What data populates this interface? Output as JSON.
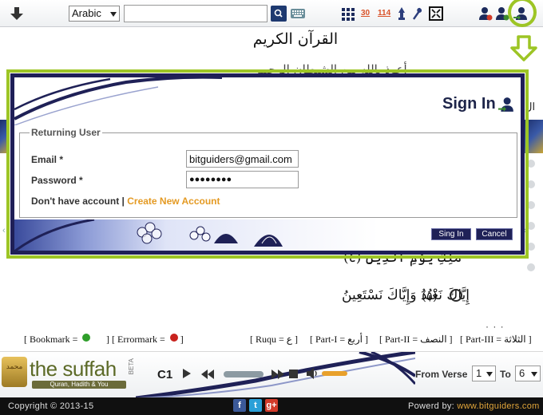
{
  "toolbar": {
    "language_select": "Arabic",
    "search_placeholder": "",
    "juz_count": "30",
    "surah_count": "114"
  },
  "quran": {
    "title": "القرآن الكريم",
    "verse_faint": "أعوذ بالله من الشيطان الرجيم",
    "verse_4": "(٤) مَٰلِكِ يَوْمِ ٱلدِّينِ",
    "verse_5_text": "إِيَّاكَ نَعْبُدُ وَإِيَّاكَ نَسْتَعِينُ",
    "verse_5_num": "(٥)",
    "verse_dots": "· · ·"
  },
  "legend": {
    "bookmark": "[ Bookmark = ",
    "errormark": "] [ Errormark = ",
    "errormark_end": "]",
    "ruqu": "[ Ruqu = ع ]",
    "part1": "[ Part-I = أربع ]",
    "part2": "[ Part-II = النصف ]",
    "part3": "[ Part-III = الثلاثة ]",
    "bookmark_color": "#2f9e2a",
    "errormark_color": "#c8221d"
  },
  "player": {
    "logo_text": "the suffah",
    "logo_sub": "Quran, Hadith & You",
    "beta": "BETA",
    "replay": "C1",
    "from_verse_label": "From Verse",
    "from_verse_value": "1",
    "to_label": "To",
    "to_verse_value": "6"
  },
  "footer": {
    "copyright": "Copyright © 2013-15",
    "powered_by": "Powerd by:",
    "powered_by_link": "www.bitguiders.com"
  },
  "modal": {
    "title": "Sign In",
    "legend": "Returning User",
    "email_label": "Email *",
    "email_value": "bitguiders@gmail.com",
    "password_label": "Password *",
    "password_value": "●●●●●●●●",
    "no_account": "Don't have account | ",
    "create_account": "Create New Account",
    "signin_button": "Sing In",
    "cancel_button": "Cancel"
  },
  "colors": {
    "accent_highlight": "#9dc525",
    "modal_border": "#1f1f57",
    "link_orange": "#e49a23"
  }
}
